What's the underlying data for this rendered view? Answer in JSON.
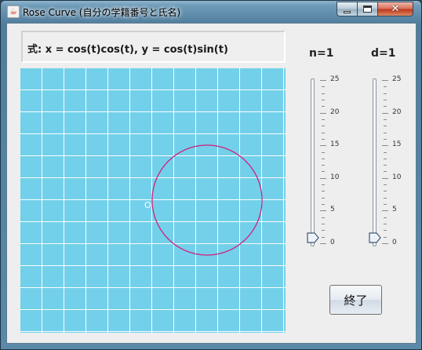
{
  "window": {
    "title": "Rose Curve (自分の学籍番号と氏名)",
    "app_icon": "java-cup-icon",
    "controls": {
      "minimize": "minimize-icon",
      "maximize": "maximize-icon",
      "close": "close-icon",
      "close_glyph": "✕"
    }
  },
  "formula": {
    "text": "式: x = cos(t)cos(t),  y = cos(t)sin(t)"
  },
  "plot": {
    "origin_label": "O",
    "grid_divisions": 12,
    "background_color": "#73d0ea",
    "grid_color": "#ffffff",
    "curve_color": "#d0207e",
    "curve_equation": {
      "n": 1,
      "d": 1
    }
  },
  "sliders": {
    "n": {
      "label": "n=1",
      "value": 1,
      "min": 0,
      "max": 25,
      "major_ticks": [
        "25",
        "20",
        "15",
        "10",
        "5",
        "0"
      ]
    },
    "d": {
      "label": "d=1",
      "value": 1,
      "min": 0,
      "max": 25,
      "major_ticks": [
        "25",
        "20",
        "15",
        "10",
        "5",
        "0"
      ]
    }
  },
  "exit_button": {
    "label": "終了"
  }
}
